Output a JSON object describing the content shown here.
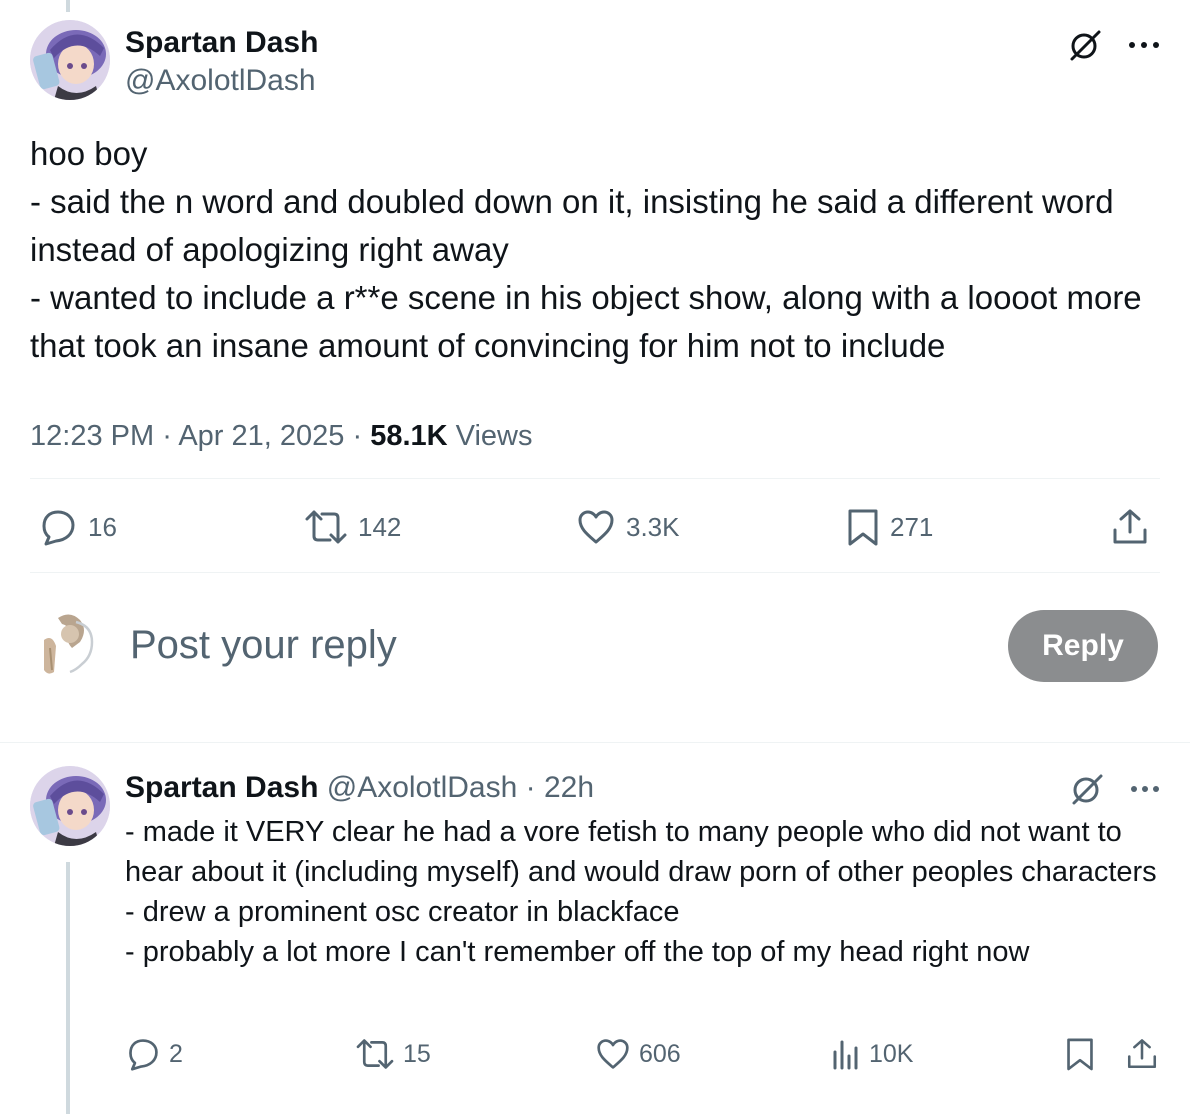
{
  "main_tweet": {
    "display_name": "Spartan Dash",
    "handle": "@AxolotlDash",
    "text": "hoo boy\n- said the n word and doubled down on it, insisting he said a different word instead of apologizing right away\n- wanted to include a r**e scene in his object show, along with a loooot more that took an insane amount of convincing for him not to include",
    "time": "12:23 PM",
    "date": "Apr 21, 2025",
    "views_count": "58.1K",
    "views_label": "Views",
    "actions": {
      "replies": "16",
      "reposts": "142",
      "likes": "3.3K",
      "bookmarks": "271"
    }
  },
  "composer": {
    "placeholder": "Post your reply",
    "reply_button": "Reply"
  },
  "reply_tweet": {
    "display_name": "Spartan Dash",
    "handle": "@AxolotlDash",
    "age": "22h",
    "text": "- made it VERY clear he had a vore fetish to many people who did not want to hear about it (including myself) and would draw porn of other peoples characters\n- drew a prominent osc creator in blackface\n- probably a lot more I can't remember off the top of my head right now",
    "actions": {
      "replies": "2",
      "reposts": "15",
      "likes": "606",
      "views": "10K"
    }
  },
  "colors": {
    "text": "#0f1419",
    "secondary": "#536471",
    "divider": "#eff3f4",
    "reply_button": "#8b8d8f",
    "thread_line": "#cfd9de"
  }
}
